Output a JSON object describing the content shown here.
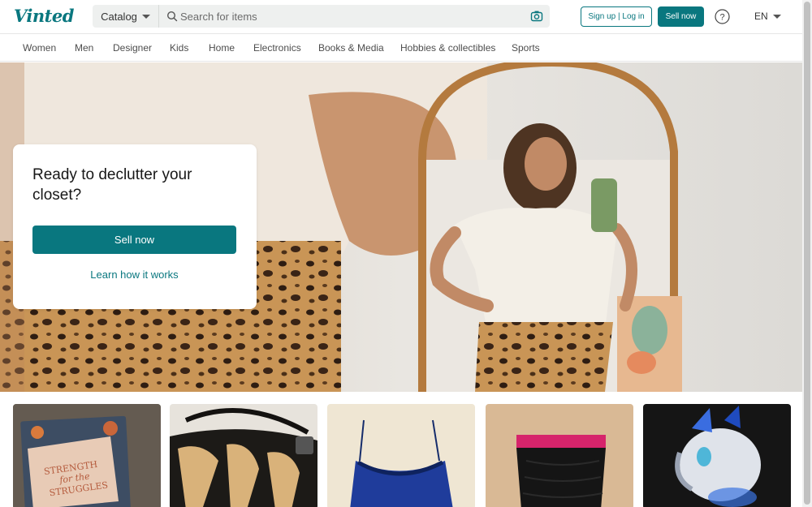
{
  "header": {
    "logo": "Vinted",
    "catalog_label": "Catalog",
    "search_placeholder": "Search for items",
    "signup_label": "Sign up | Log in",
    "sell_label": "Sell now",
    "language": "EN"
  },
  "nav": {
    "items": [
      "Women",
      "Men",
      "Designer",
      "Kids",
      "Home",
      "Electronics",
      "Books & Media",
      "Hobbies & collectibles",
      "Sports"
    ]
  },
  "hero": {
    "title": "Ready to declutter your closet?",
    "sell_button": "Sell now",
    "learn_link": "Learn how it works"
  },
  "items": [
    {
      "name": "book-strength-for-the-struggles",
      "text": "STRENGTH for the STRUGGLES"
    },
    {
      "name": "zebra-print-bag"
    },
    {
      "name": "blue-lace-cami-top"
    },
    {
      "name": "black-pink-tube-top"
    },
    {
      "name": "white-pony-toy"
    }
  ],
  "colors": {
    "brand": "#09777f",
    "text": "#171717",
    "muted": "#4d4d4d",
    "search_bg": "#eef0ef"
  },
  "icons": [
    "search-icon",
    "camera-icon",
    "help-icon",
    "chevron-down-icon"
  ]
}
